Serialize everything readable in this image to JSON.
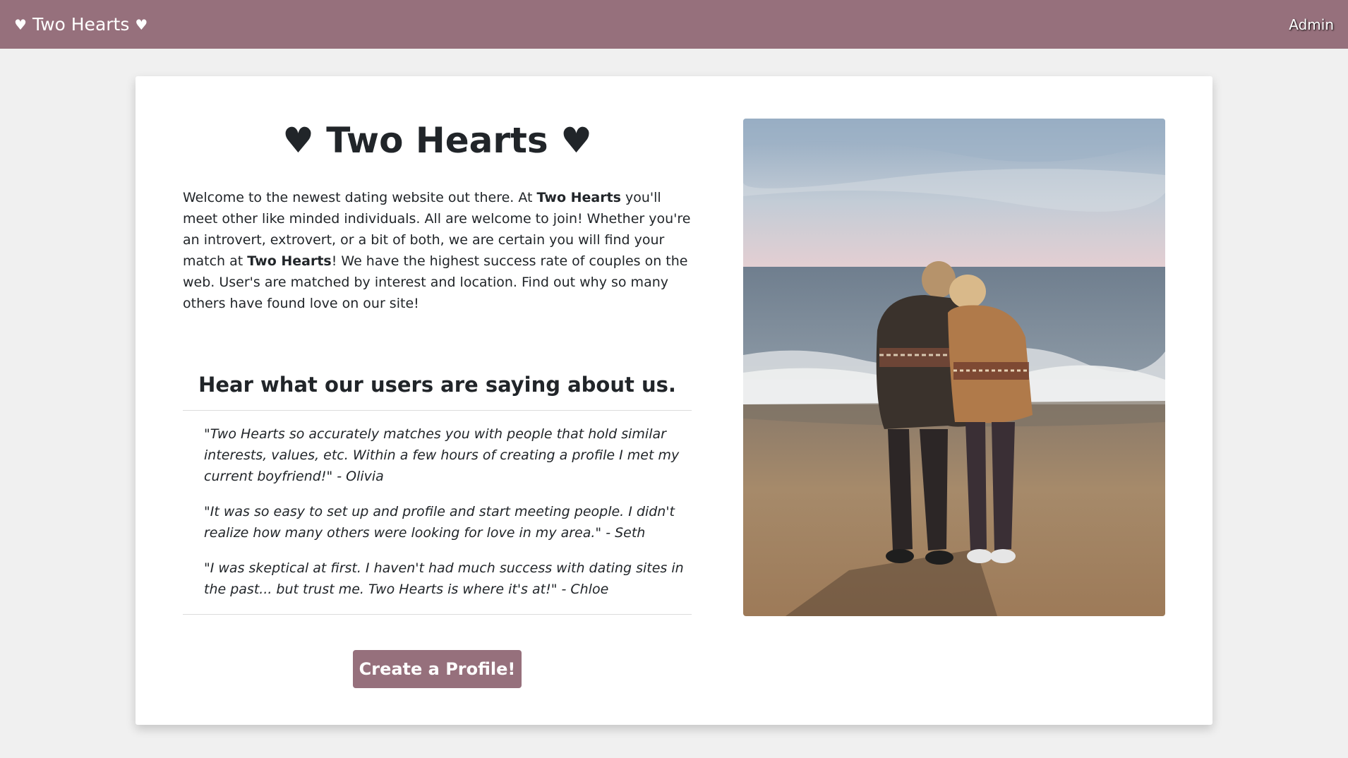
{
  "navbar": {
    "brand_heart_left": "♥",
    "brand_label": "Two Hearts",
    "brand_heart_right": "♥",
    "admin_label": "Admin"
  },
  "main": {
    "title": "♥ Two Hearts ♥",
    "intro_parts": [
      "Welcome to the newest dating website out there. At ",
      "Two Hearts",
      " you'll meet other like minded individuals. All are welcome to join! Whether you're an introvert, extrovert, or a bit of both, we are certain you will find your match at ",
      "Two Hearts",
      "! We have the highest success rate of couples on the web. User's are matched by interest and location. Find out why so many others have found love on our site!"
    ],
    "testimonials_heading": "Hear what our users are saying about us.",
    "testimonials": [
      "\"Two Hearts so accurately matches you with people that hold similar interests, values, etc. Within a few hours of creating a profile I met my current boyfriend!\" - Olivia",
      "\"It was so easy to set up and profile and start meeting people. I didn't realize how many others were looking for love in my area.\" - Seth",
      "\"I was skeptical at first. I haven't had much success with dating sites in the past... but trust me. Two Hearts is where it's at!\" - Chloe"
    ],
    "cta_label": "Create a Profile!"
  },
  "colors": {
    "accent": "#96707c",
    "background": "#f0f0f0",
    "card": "#ffffff",
    "text": "#212529"
  }
}
